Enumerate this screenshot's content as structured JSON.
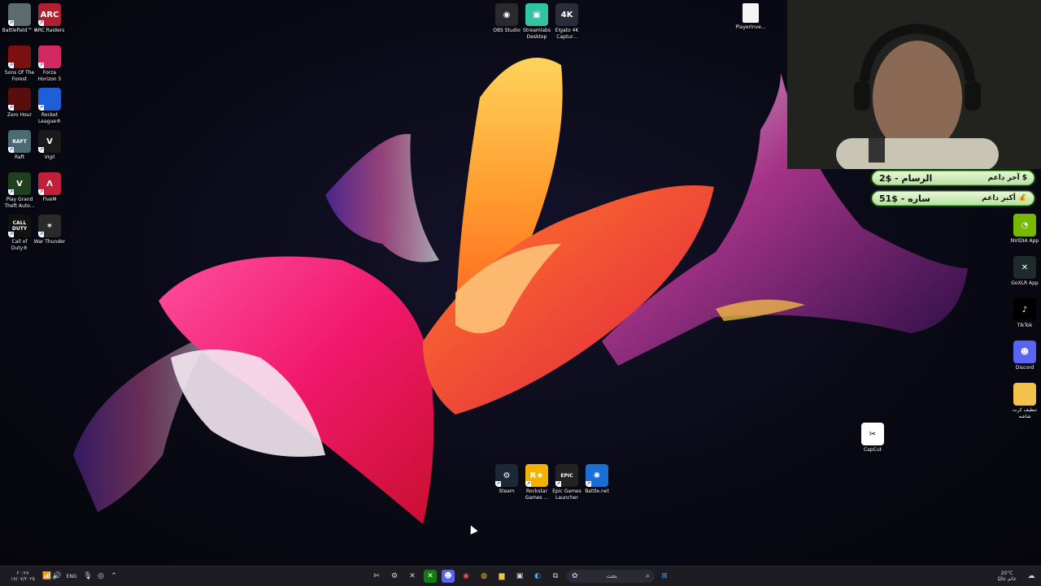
{
  "desktop": {
    "left_icons": [
      {
        "label": "Battlefield™ 6",
        "name": "battlefield-6-icon",
        "bg": "#5b6b6e",
        "glyph": ""
      },
      {
        "label": "ARC Raiders",
        "name": "arc-raiders-icon",
        "bg": "#b02030",
        "glyph": "ARC"
      },
      {
        "label": "Sons Of The\nForest",
        "name": "sons-of-the-forest-icon",
        "bg": "#7a1010",
        "glyph": ""
      },
      {
        "label": "Forza\nHorizon 5",
        "name": "forza-horizon-5-icon",
        "bg": "#d42860",
        "glyph": ""
      },
      {
        "label": "Zero Hour",
        "name": "zero-hour-icon",
        "bg": "#5a0d0d",
        "glyph": ""
      },
      {
        "label": "Rocket\nLeague®",
        "name": "rocket-league-icon",
        "bg": "#1e5fd8",
        "glyph": ""
      },
      {
        "label": "Raft",
        "name": "raft-icon",
        "bg": "#4b6b74",
        "glyph": "RAFT"
      },
      {
        "label": "Vigil",
        "name": "vigil-icon",
        "bg": "#1a1a1a",
        "glyph": "V"
      },
      {
        "label": "Play Grand\nTheft Auto...",
        "name": "gta-v-icon",
        "bg": "#1f3f1f",
        "glyph": "V"
      },
      {
        "label": "FiveM",
        "name": "fivem-icon",
        "bg": "#c0203a",
        "glyph": "Λ"
      },
      {
        "label": "Call of\nDuty®",
        "name": "call-of-duty-icon",
        "bg": "#111",
        "glyph": "CALL\nDUTY"
      },
      {
        "label": "War Thunder",
        "name": "war-thunder-icon",
        "bg": "#2a2a2a",
        "glyph": "✶"
      }
    ],
    "top_icons": [
      {
        "label": "OBS Studio",
        "name": "obs-studio-icon",
        "bg": "#2a2a2e",
        "glyph": "◉"
      },
      {
        "label": "Streamlabs\nDesktop",
        "name": "streamlabs-desktop-icon",
        "bg": "#31c3a2",
        "glyph": "▣"
      },
      {
        "label": "Elgato 4K\nCaptur...",
        "name": "elgato-4k-capture-icon",
        "bg": "#2a2c3a",
        "glyph": "4K"
      }
    ],
    "file_icon": {
      "label": "PlayerInve...",
      "name": "player-inventory-file-icon"
    },
    "bottom_icons": [
      {
        "label": "Steam",
        "name": "steam-icon",
        "bg": "#1b2838",
        "glyph": "⚙"
      },
      {
        "label": "Rockstar\nGames ...",
        "name": "rockstar-games-icon",
        "bg": "#f3b100",
        "glyph": "R★"
      },
      {
        "label": "Epic Games\nLauncher",
        "name": "epic-games-launcher-icon",
        "bg": "#222",
        "glyph": "EPIC"
      },
      {
        "label": "Battle.net",
        "name": "battlenet-icon",
        "bg": "#1a6fd6",
        "glyph": "✺"
      }
    ],
    "right_icons": [
      {
        "label": "NVIDIA App",
        "name": "nvidia-app-icon",
        "bg": "#76b900",
        "glyph": "◔"
      },
      {
        "label": "GoXLR App",
        "name": "goxlr-app-icon",
        "bg": "#1f2a2a",
        "glyph": "✕"
      },
      {
        "label": "TikTok",
        "name": "tiktok-icon",
        "bg": "#000",
        "glyph": "♪"
      },
      {
        "label": "Discord",
        "name": "discord-icon",
        "bg": "#5865f2",
        "glyph": "☻"
      },
      {
        "label": "تنظيف كرت\nشاشه",
        "name": "gpu-clean-folder-icon",
        "bg": "#f1c24c",
        "glyph": ""
      }
    ],
    "capcut": {
      "label": "CapCut",
      "name": "capcut-icon",
      "glyph": "✂"
    }
  },
  "donations": [
    {
      "name": "الرسام",
      "amount": "2$",
      "tag": "آخر داعم",
      "icon": "$"
    },
    {
      "name": "ساره",
      "amount": "51$",
      "tag": "أكبر داعم",
      "icon": "💰"
    }
  ],
  "taskbar": {
    "clock_time": "٢٠:٢٧",
    "clock_date": "١٧/٠٧/٢٠٢٥",
    "language": "ENG",
    "search_placeholder": "بحث",
    "weather_temp": "20°C",
    "weather_text": "غائم غالبًا"
  }
}
